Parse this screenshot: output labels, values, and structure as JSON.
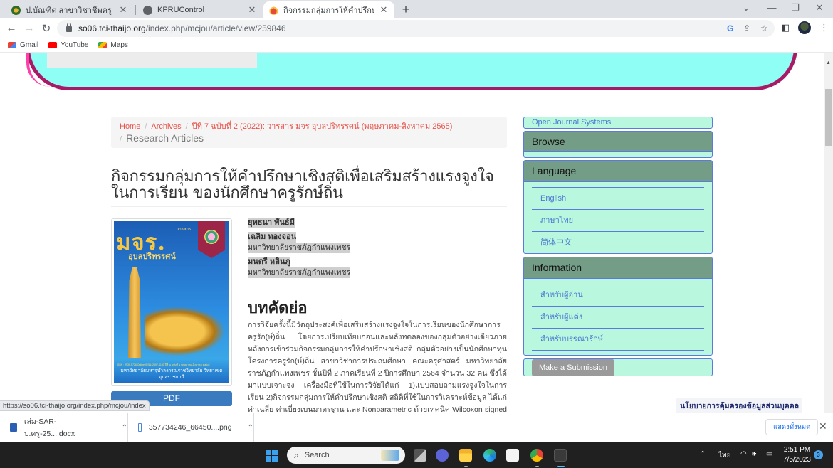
{
  "browser": {
    "tabs": [
      {
        "title": "ป.บัณฑิต สาขาวิชาชีพครู คณะครุศาสตร์",
        "active": false
      },
      {
        "title": "KPRUControl",
        "active": false
      },
      {
        "title": "กิจกรรมกลุ่มการให้คำปรึกษาเชิงสติเพื่อ",
        "active": true
      }
    ],
    "new_tab_symbol": "+",
    "url_host": "so06.tci-thaijo.org",
    "url_path": "/index.php/mcjou/article/view/259846",
    "bookmarks": [
      {
        "label": "Gmail",
        "icon": "gmail-icon"
      },
      {
        "label": "YouTube",
        "icon": "youtube-icon"
      },
      {
        "label": "Maps",
        "icon": "maps-icon"
      }
    ],
    "status_url": "https://so06.tci-thaijo.org/index.php/mcjou/index"
  },
  "breadcrumb": {
    "home": "Home",
    "archives": "Archives",
    "issue": "ปีที่ 7 ฉบับที่ 2 (2022): วารสาร มจร อุบลปริทรรศน์ (พฤษภาคม-สิงหาคม 2565)",
    "section": "Research Articles",
    "separator": "/"
  },
  "article": {
    "title": "กิจกรรมกลุ่มการให้คำปรึกษาเชิงสติเพื่อเสริมสร้างแรงจูงใจในการเรียน ของนักศึกษาครูรักษ์ถิ่น",
    "authors": [
      {
        "name": "ยุทธนา พันธ์มี",
        "affiliation": ""
      },
      {
        "name": "เฉลิม ทองจอน",
        "affiliation": "มหาวิทยาลัยราชภัฏกำแพงเพชร"
      },
      {
        "name": "มนตรี หลินภู",
        "affiliation": "มหาวิทยาลัยราชภัฏกำแพงเพชร"
      }
    ],
    "abstract_heading": "บทคัดย่อ",
    "abstract_text": "การวิจัยครั้งนี้มีวัตถุประสงค์เพื่อเสริมสร้างแรงจูงใจในการเรียนของนักศึกษาการครูรัก(ษ์)ถิ่น โดยการเปรียบเทียบก่อนและหลังทดลองของกลุ่มตัวอย่างเดียวภายหลังการเข้าร่วมกิจกรรมกลุ่มการให้คำปรึกษาเชิงสติ กลุ่มตัวอย่างเป็นนักศึกษาทุนโครงการครูรัก(ษ์)ถิ่น สาขาวิชาการประถมศึกษา คณะครุศาสตร์ มหาวิทยาลัยราชภัฏกำแพงเพชร ชั้นปีที่ 2 ภาคเรียนที่ 2 ปีการศึกษา 2564 จำนวน 32 คน ซึ่งได้มาแบบเจาะจง เครื่องมือที่ใช้ในการวิจัยได้แก่ 1)แบบสอบถามแรงจูงใจในการเรียน 2)กิจกรรมกลุ่มการให้คำปรึกษาเชิงสติ สถิติที่ใช้ในการวิเคราะห์ข้อมูล ได้แก่ ค่าเฉลี่ย ค่าเบี่ยงเบนมาตรฐาน และ Nonparametric ด้วยเทคนิค Wilcoxon signed Rank",
    "pdf_label": "PDF",
    "cover": {
      "small_label": "วารสาร",
      "journal_name": "มจร.",
      "journal_sub": "อุบลปริทรรศน์",
      "issn_line": "ISSN : 2539-5726 Online ISSN: 2697-4150 ปีที่ ๗ ฉบับที่ ๒ พฤษภาคม-สิงหาคม ๒๕๖๕",
      "university": "มหาวิทยาลัยมหาจุฬาลงกรณราชวิทยาลัย วิทยาเขตอุบลราชธานี"
    }
  },
  "sidebar": {
    "ojs_link": "Open Journal Systems",
    "browse_heading": "Browse",
    "language_heading": "Language",
    "languages": [
      "English",
      "ภาษาไทย",
      "简体中文"
    ],
    "information_heading": "Information",
    "information_links": [
      "สำหรับผู้อ่าน",
      "สำหรับผู้แต่ง",
      "สำหรับบรรณารักษ์"
    ],
    "submit_label": "Make a Submission"
  },
  "privacy_policy": "นโยบายการคุ้มครองข้อมูลส่วนบุคคล",
  "downloads": {
    "items": [
      {
        "name": "เล่ม-SAR-ป.ครู-25....docx",
        "type": "docx"
      },
      {
        "name": "357734246_66450....png",
        "type": "png"
      }
    ],
    "show_all": "แสดงทั้งหมด"
  },
  "taskbar": {
    "search_placeholder": "Search",
    "language": "ไทย",
    "time": "2:51 PM",
    "date": "7/5/2023",
    "notification_count": "3"
  },
  "colors": {
    "header_fill": "#8ffff6",
    "header_border": "#a81a66",
    "breadcrumb_link": "#e8534a",
    "sidebar_bg": "#b9f7de",
    "sidebar_head": "#739d86",
    "sidebar_link": "#4b79d2",
    "pdf_button": "#3a7bbf"
  }
}
